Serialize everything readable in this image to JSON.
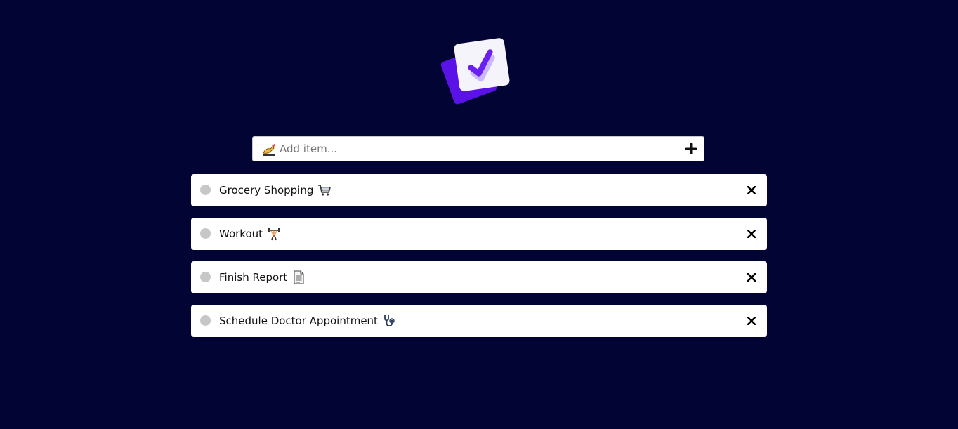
{
  "app": {
    "logo_icon": "checkbox-logo-icon"
  },
  "add_item": {
    "placeholder": "Add item...",
    "value": "",
    "leading_icon": "writing-hand-icon",
    "submit_icon": "plus-icon"
  },
  "todos": [
    {
      "label": "Grocery Shopping",
      "emoji": "shopping-cart-icon",
      "completed": false
    },
    {
      "label": "Workout",
      "emoji": "weightlifter-icon",
      "completed": false
    },
    {
      "label": "Finish Report",
      "emoji": "document-icon",
      "completed": false
    },
    {
      "label": "Schedule Doctor Appointment",
      "emoji": "stethoscope-icon",
      "completed": false
    }
  ],
  "colors": {
    "background": "#020433",
    "accent": "#6c2bff",
    "checkbox": "#c7c7c7"
  }
}
